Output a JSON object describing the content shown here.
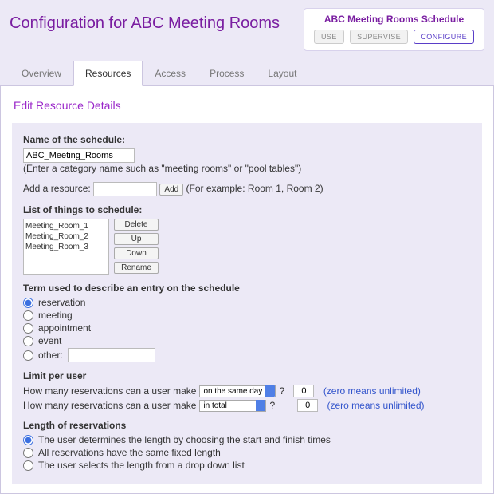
{
  "header": {
    "title": "Configuration for ABC Meeting Rooms",
    "box_title": "ABC Meeting Rooms Schedule",
    "btn_use": "USE",
    "btn_supervise": "SUPERVISE",
    "btn_configure": "CONFIGURE"
  },
  "tabs": {
    "overview": "Overview",
    "resources": "Resources",
    "access": "Access",
    "process": "Process",
    "layout": "Layout"
  },
  "section_heading": "Edit Resource Details",
  "schedule_name": {
    "label": "Name of the schedule:",
    "value": "ABC_Meeting_Rooms",
    "hint": "(Enter a category name such as \"meeting rooms\" or \"pool tables\")"
  },
  "add_resource": {
    "label": "Add a resource:",
    "value": "",
    "btn": "Add",
    "hint": "(For example: Room 1, Room 2)"
  },
  "resource_list": {
    "label": "List of things to schedule:",
    "items": [
      "Meeting_Room_1",
      "Meeting_Room_2",
      "Meeting_Room_3"
    ],
    "btn_delete": "Delete",
    "btn_up": "Up",
    "btn_down": "Down",
    "btn_rename": "Rename"
  },
  "term": {
    "label": "Term used to describe an entry on the schedule",
    "reservation": "reservation",
    "meeting": "meeting",
    "appointment": "appointment",
    "event": "event",
    "other": "other:",
    "other_value": ""
  },
  "limit": {
    "label": "Limit per user",
    "q_prefix": "How many reservations can a user make",
    "sel1": "on the same day",
    "sel2": "in total",
    "q_suffix": "?",
    "val1": "0",
    "val2": "0",
    "note": "(zero means unlimited)"
  },
  "length": {
    "label": "Length of reservations",
    "opt1": "The user determines the length by choosing the start and finish times",
    "opt2": "All reservations have the same fixed length",
    "opt3": "The user selects the length from a drop down list"
  }
}
